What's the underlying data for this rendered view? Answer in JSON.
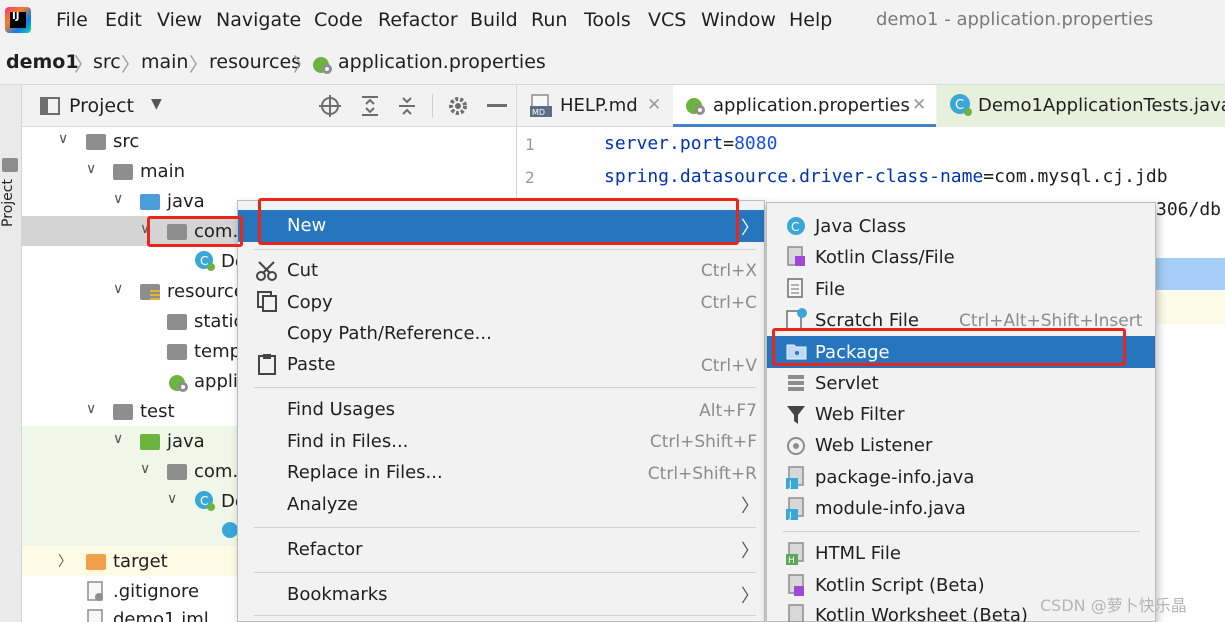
{
  "window_title": "demo1 - application.properties",
  "menu": [
    "File",
    "Edit",
    "View",
    "Navigate",
    "Code",
    "Refactor",
    "Build",
    "Run",
    "Tools",
    "VCS",
    "Window",
    "Help"
  ],
  "breadcrumb": [
    "demo1",
    "src",
    "main",
    "resources",
    "application.properties"
  ],
  "left_stripe_label": "Project",
  "project_panel": {
    "title": "Project"
  },
  "tree": [
    {
      "label": "src"
    },
    {
      "label": "main"
    },
    {
      "label": "java"
    },
    {
      "label": "com.e"
    },
    {
      "label": "De"
    },
    {
      "label": "resource"
    },
    {
      "label": "static"
    },
    {
      "label": "temp"
    },
    {
      "label": "appli"
    },
    {
      "label": "test"
    },
    {
      "label": "java"
    },
    {
      "label": "com.e"
    },
    {
      "label": "De"
    },
    {
      "label": "target"
    },
    {
      "label": ".gitignore"
    },
    {
      "label": "demo1.iml"
    }
  ],
  "editor_tabs": [
    {
      "label": "HELP.md",
      "badge": "MD"
    },
    {
      "label": "application.properties"
    },
    {
      "label": "Demo1ApplicationTests.java"
    }
  ],
  "editor_lines": [
    {
      "no": "1",
      "key": "server.port",
      "eq": "=",
      "value": "8080"
    },
    {
      "no": "2",
      "key": "spring.datasource.driver-class-name",
      "eq": "=",
      "value": "com.mysql.cj.jdb"
    }
  ],
  "editor_fragment": "306/db",
  "context_menu": {
    "new": "New",
    "cut": "Cut",
    "cut_sc": "Ctrl+X",
    "copy": "Copy",
    "copy_sc": "Ctrl+C",
    "copy_path": "Copy Path/Reference...",
    "paste": "Paste",
    "paste_sc": "Ctrl+V",
    "find_usages": "Find Usages",
    "find_usages_sc": "Alt+F7",
    "find_in_files": "Find in Files...",
    "find_in_files_sc": "Ctrl+Shift+F",
    "replace_in_files": "Replace in Files...",
    "replace_in_files_sc": "Ctrl+Shift+R",
    "analyze": "Analyze",
    "refactor": "Refactor",
    "bookmarks": "Bookmarks"
  },
  "new_submenu": {
    "java_class": "Java Class",
    "kotlin_class": "Kotlin Class/File",
    "file": "File",
    "scratch_file": "Scratch File",
    "scratch_file_sc": "Ctrl+Alt+Shift+Insert",
    "package": "Package",
    "servlet": "Servlet",
    "web_filter": "Web Filter",
    "web_listener": "Web Listener",
    "package_info": "package-info.java",
    "module_info": "module-info.java",
    "html_file": "HTML File",
    "kotlin_script": "Kotlin Script (Beta)",
    "kotlin_worksheet": "Kotlin Worksheet (Beta)"
  },
  "watermark": "CSDN @萝卜快乐晶",
  "colors": {
    "selection": "#2675bf",
    "annotation_red": "#e8261c",
    "spring_green": "#6db33f",
    "folder_blue": "#4a9edb"
  }
}
